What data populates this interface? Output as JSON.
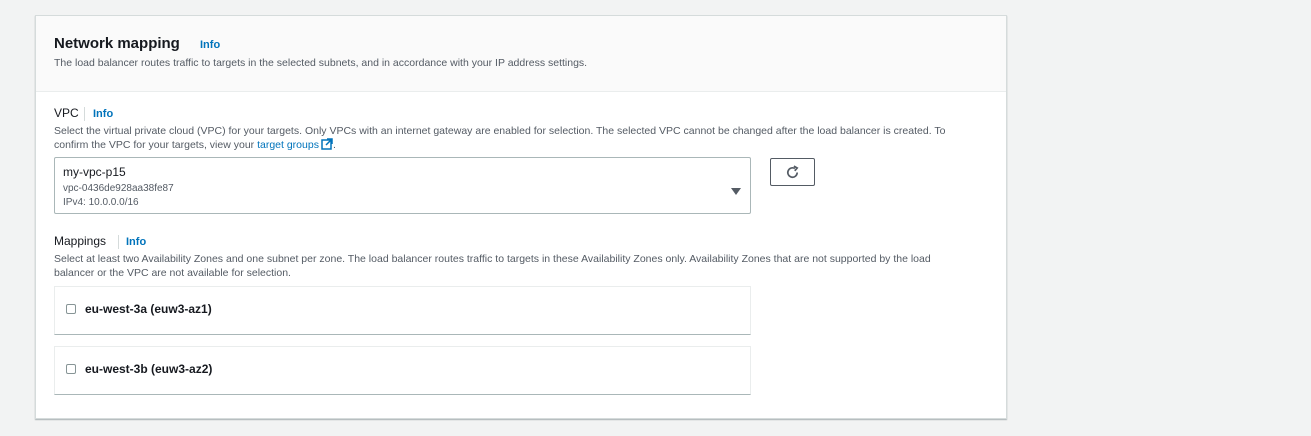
{
  "section": {
    "title": "Network mapping",
    "info": "Info",
    "description": "The load balancer routes traffic to targets in the selected subnets, and in accordance with your IP address settings."
  },
  "vpc": {
    "label": "VPC",
    "info": "Info",
    "description_line1": "Select the virtual private cloud (VPC) for your targets. Only VPCs with an internet gateway are enabled for selection. The selected VPC cannot be changed after the load balancer is created. To",
    "description_line2_prefix": "confirm the VPC for your targets, view your ",
    "description_link": "target groups",
    "description_suffix": ".",
    "selected": {
      "name": "my-vpc-p15",
      "id": "vpc-0436de928aa38fe87",
      "cidr": "IPv4: 10.0.0.0/16"
    }
  },
  "mappings": {
    "label": "Mappings",
    "info": "Info",
    "description_line1": "Select at least two Availability Zones and one subnet per zone. The load balancer routes traffic to targets in these Availability Zones only. Availability Zones that are not supported by the load",
    "description_line2": "balancer or the VPC are not available for selection.",
    "zones": [
      {
        "label": "eu-west-3a (euw3-az1)",
        "checked": false
      },
      {
        "label": "eu-west-3b (euw3-az2)",
        "checked": false
      }
    ]
  },
  "colors": {
    "link": "#0073bb",
    "page_background": "#f2f3f3",
    "text": "#16191f",
    "muted_text": "#545b64"
  },
  "icons": {
    "refresh": "refresh-icon",
    "dropdown": "caret-down-icon",
    "external": "external-link-icon"
  }
}
